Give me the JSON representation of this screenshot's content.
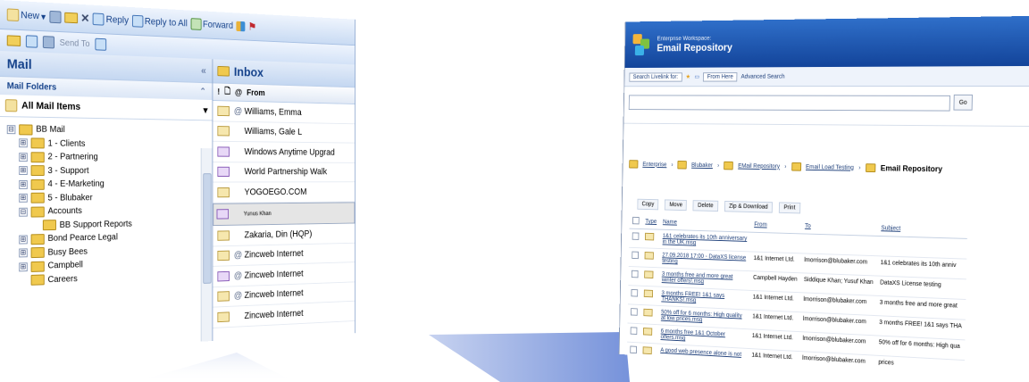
{
  "outlook": {
    "toolbar": {
      "new_label": "New",
      "reply_label": "Reply",
      "reply_all_label": "Reply to All",
      "forward_label": "Forward",
      "send_to_label": "Send To"
    },
    "nav": {
      "title": "Mail",
      "collapse_glyph": "«",
      "folders_title": "Mail Folders",
      "all_items_label": "All Mail Items",
      "tree": [
        {
          "label": "BB Mail",
          "level": 0,
          "expander": "⊟"
        },
        {
          "label": "1 - Clients",
          "level": 1,
          "expander": "⊞"
        },
        {
          "label": "2 - Partnering",
          "level": 1,
          "expander": "⊞"
        },
        {
          "label": "3 - Support",
          "level": 1,
          "expander": "⊞"
        },
        {
          "label": "4 - E-Marketing",
          "level": 1,
          "expander": "⊞"
        },
        {
          "label": "5 - Blubaker",
          "level": 1,
          "expander": "⊞"
        },
        {
          "label": "Accounts",
          "level": 1,
          "expander": "⊟"
        },
        {
          "label": "BB Support Reports",
          "level": 2,
          "expander": ""
        },
        {
          "label": "Bond Pearce Legal",
          "level": 1,
          "expander": "⊞"
        },
        {
          "label": "Busy Bees",
          "level": 1,
          "expander": "⊞"
        },
        {
          "label": "Campbell",
          "level": 1,
          "expander": "⊞"
        },
        {
          "label": "Careers",
          "level": 1,
          "expander": ""
        }
      ]
    },
    "inbox": {
      "title": "Inbox",
      "col_from": "From",
      "messages": [
        {
          "from": "Williams, Emma",
          "attach": true,
          "purple": false,
          "selected": false
        },
        {
          "from": "Williams, Gale L",
          "attach": false,
          "purple": false,
          "selected": false
        },
        {
          "from": "Windows Anytime Upgrad",
          "attach": false,
          "purple": true,
          "selected": false
        },
        {
          "from": "World Partnership Walk",
          "attach": false,
          "purple": true,
          "selected": false
        },
        {
          "from": "YOGOEGO.COM",
          "attach": false,
          "purple": false,
          "selected": false
        },
        {
          "from": "Yunus Khan",
          "attach": false,
          "purple": true,
          "selected": true
        },
        {
          "from": "Zakaria, Din (HQP)",
          "attach": false,
          "purple": false,
          "selected": false
        },
        {
          "from": "Zincweb Internet",
          "attach": true,
          "purple": false,
          "selected": false
        },
        {
          "from": "Zincweb Internet",
          "attach": true,
          "purple": true,
          "selected": false
        },
        {
          "from": "Zincweb Internet",
          "attach": true,
          "purple": false,
          "selected": false
        },
        {
          "from": "Zincweb Internet",
          "attach": false,
          "purple": false,
          "selected": false
        }
      ]
    }
  },
  "ew": {
    "brand_small": "Enterprise Workspace:",
    "brand_title": "Email Repository",
    "search_label": "Search Livelink for:",
    "search_scope": "From Here",
    "advanced_search": "Advanced Search",
    "go_label": "Go",
    "breadcrumb": [
      "Enterprise",
      "Blubaker",
      "EMail Repository",
      "Email Load Testing"
    ],
    "breadcrumb_current": "Email Repository",
    "tools": [
      "Copy",
      "Move",
      "Delete",
      "Zip & Download",
      "Print"
    ],
    "columns": [
      "Type",
      "Name",
      "From",
      "To",
      "Subject"
    ],
    "rows": [
      {
        "name": "1&1 celebrates its 10th anniversary in the UK.msg",
        "from": "",
        "to": "",
        "subject": ""
      },
      {
        "name": "27.09.2018 17:00 - DataXS license testing",
        "from": "1&1 Internet Ltd.",
        "to": "lmorrison@blubaker.com",
        "subject": "1&1 celebrates its 10th anniv"
      },
      {
        "name": "3 months free and more great winter offers!.msg",
        "from": "Campbell Hayden",
        "to": "Siddique Khan; Yusuf Khan",
        "subject": "DataXS License testing"
      },
      {
        "name": "3 months FREE! 1&1 says THANKS!.msg",
        "from": "1&1 Internet Ltd.",
        "to": "lmorrison@blubaker.com",
        "subject": "3 months free and more great"
      },
      {
        "name": "50% off for 6 months: High quality at low prices.msg",
        "from": "1&1 Internet Ltd.",
        "to": "lmorrison@blubaker.com",
        "subject": "3 months FREE! 1&1 says THA"
      },
      {
        "name": "6 months free 1&1 October offers.msg",
        "from": "1&1 Internet Ltd.",
        "to": "lmorrison@blubaker.com",
        "subject": "50% off for 6 months: High qua"
      },
      {
        "name": "A good web presence alone is not",
        "from": "1&1 Internet Ltd.",
        "to": "lmorrison@blubaker.com",
        "subject": "prices"
      }
    ]
  }
}
